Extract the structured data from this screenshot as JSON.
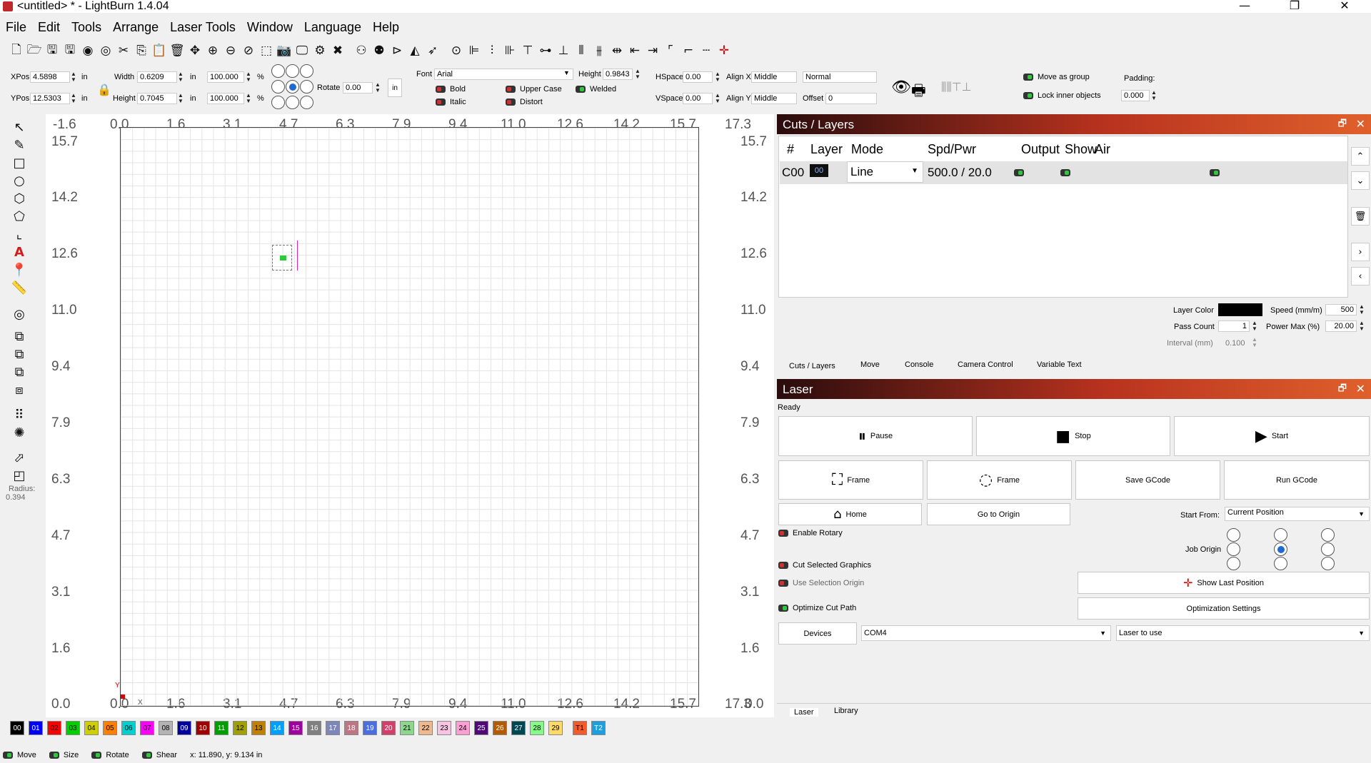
{
  "window": {
    "title": "<untitled> * - LightBurn 1.4.04",
    "min": "—",
    "max": "❐",
    "close": "✕"
  },
  "menu": [
    "File",
    "Edit",
    "Tools",
    "Arrange",
    "Laser Tools",
    "Window",
    "Language",
    "Help"
  ],
  "props": {
    "xpos_label": "XPos",
    "xpos": "4.5898",
    "ypos_label": "YPos",
    "ypos": "12.5303",
    "unit": "in",
    "width_label": "Width",
    "width": "0.6209",
    "height_label": "Height",
    "height": "0.7045",
    "pct_w": "100.000",
    "pct_h": "100.000",
    "pct": "%",
    "rotate_label": "Rotate",
    "rotate": "0.00",
    "in_btn": "in"
  },
  "text": {
    "font_label": "Font",
    "font": "Arial",
    "height_label": "Height",
    "height": "0.9843",
    "hspace_label": "HSpace",
    "hspace": "0.00",
    "vspace_label": "VSpace",
    "vspace": "0.00",
    "alignx_label": "Align X",
    "alignx": "Middle",
    "aligny_label": "Align Y",
    "aligny": "Middle",
    "mode": "Normal",
    "offset_label": "Offset",
    "offset": "0",
    "bold": "Bold",
    "italic": "Italic",
    "upper": "Upper Case",
    "distort": "Distort",
    "welded": "Welded"
  },
  "group": {
    "move_as_group": "Move as group",
    "lock_inner": "Lock inner objects",
    "padding_label": "Padding:",
    "padding": "0.000"
  },
  "ruler": {
    "x": [
      "-1.6",
      "0.0",
      "1.6",
      "3.1",
      "4.7",
      "6.3",
      "7.9",
      "9.4",
      "11.0",
      "12.6",
      "14.2",
      "15.7",
      "17.3"
    ],
    "y": [
      "15.7",
      "14.2",
      "12.6",
      "11.0",
      "9.4",
      "7.9",
      "6.3",
      "4.7",
      "3.1",
      "1.6"
    ],
    "bottom_left": "0.0",
    "bottom_left2": "-1.6",
    "bottom_right": "0.0",
    "y_mark": "Y",
    "x_mark": "X"
  },
  "radius": {
    "label": "Radius:",
    "value": "0.394"
  },
  "cuts": {
    "title": "Cuts / Layers",
    "cols": [
      "#",
      "Layer",
      "Mode",
      "Spd/Pwr",
      "Output",
      "Show",
      "Air"
    ],
    "row": {
      "id": "C00",
      "layer": "00",
      "mode": "Line",
      "spdpwr": "500.0 / 20.0"
    },
    "layer_color": "Layer Color",
    "speed_label": "Speed (mm/m)",
    "speed": "500",
    "pass_label": "Pass Count",
    "pass": "1",
    "power_label": "Power Max (%)",
    "power": "20.00",
    "interval_label": "Interval (mm)",
    "interval": "0.100"
  },
  "tabs_top": [
    "Cuts / Layers",
    "Move",
    "Console",
    "Camera Control",
    "Variable Text"
  ],
  "laser": {
    "title": "Laser",
    "status": "Ready",
    "pause": "Pause",
    "stop": "Stop",
    "start": "Start",
    "frame1": "Frame",
    "frame2": "Frame",
    "save_gcode": "Save GCode",
    "run_gcode": "Run GCode",
    "home": "Home",
    "go_origin": "Go to Origin",
    "start_from_label": "Start From:",
    "start_from": "Current Position",
    "enable_rotary": "Enable Rotary",
    "job_origin": "Job Origin",
    "cut_selected": "Cut Selected Graphics",
    "use_sel_origin": "Use Selection Origin",
    "show_last": "Show Last Position",
    "optimize": "Optimize Cut Path",
    "opt_settings": "Optimization Settings",
    "devices": "Devices",
    "port": "COM4",
    "laser_to_use": "Laser to use"
  },
  "tabs_bottom": [
    "Laser",
    "Library"
  ],
  "palette": [
    {
      "l": "00",
      "c": "#000000",
      "t": "#fff"
    },
    {
      "l": "01",
      "c": "#0000ff",
      "t": "#fff"
    },
    {
      "l": "02",
      "c": "#ff0000",
      "t": "#000"
    },
    {
      "l": "03",
      "c": "#00d000",
      "t": "#000"
    },
    {
      "l": "04",
      "c": "#d0d000",
      "t": "#000"
    },
    {
      "l": "05",
      "c": "#ff8000",
      "t": "#000"
    },
    {
      "l": "06",
      "c": "#00d0d0",
      "t": "#000"
    },
    {
      "l": "07",
      "c": "#ff00ff",
      "t": "#000"
    },
    {
      "l": "08",
      "c": "#b4b4b4",
      "t": "#000"
    },
    {
      "l": "09",
      "c": "#0000a0",
      "t": "#fff"
    },
    {
      "l": "10",
      "c": "#a00000",
      "t": "#fff"
    },
    {
      "l": "11",
      "c": "#00a000",
      "t": "#fff"
    },
    {
      "l": "12",
      "c": "#a0a000",
      "t": "#000"
    },
    {
      "l": "13",
      "c": "#c08000",
      "t": "#000"
    },
    {
      "l": "14",
      "c": "#00a0ff",
      "t": "#fff"
    },
    {
      "l": "15",
      "c": "#a000a0",
      "t": "#fff"
    },
    {
      "l": "16",
      "c": "#808080",
      "t": "#fff"
    },
    {
      "l": "17",
      "c": "#7d87b9",
      "t": "#fff"
    },
    {
      "l": "18",
      "c": "#bb7784",
      "t": "#fff"
    },
    {
      "l": "19",
      "c": "#4a6fe3",
      "t": "#fff"
    },
    {
      "l": "20",
      "c": "#d33f6a",
      "t": "#fff"
    },
    {
      "l": "21",
      "c": "#8cd78c",
      "t": "#000"
    },
    {
      "l": "22",
      "c": "#f0b98d",
      "t": "#000"
    },
    {
      "l": "23",
      "c": "#f6c4e1",
      "t": "#000"
    },
    {
      "l": "24",
      "c": "#fa9ed4",
      "t": "#000"
    },
    {
      "l": "25",
      "c": "#500a78",
      "t": "#fff"
    },
    {
      "l": "26",
      "c": "#b45a00",
      "t": "#fff"
    },
    {
      "l": "27",
      "c": "#004754",
      "t": "#fff"
    },
    {
      "l": "28",
      "c": "#86fa88",
      "t": "#000"
    },
    {
      "l": "29",
      "c": "#ffdb66",
      "t": "#000"
    },
    {
      "l": "T1",
      "c": "#f35c2a",
      "t": "#000"
    },
    {
      "l": "T2",
      "c": "#1a9fe0",
      "t": "#fff"
    }
  ],
  "status": {
    "move": "Move",
    "size": "Size",
    "rotate": "Rotate",
    "shear": "Shear",
    "coords": "x: 11.890, y: 9.134 in"
  }
}
